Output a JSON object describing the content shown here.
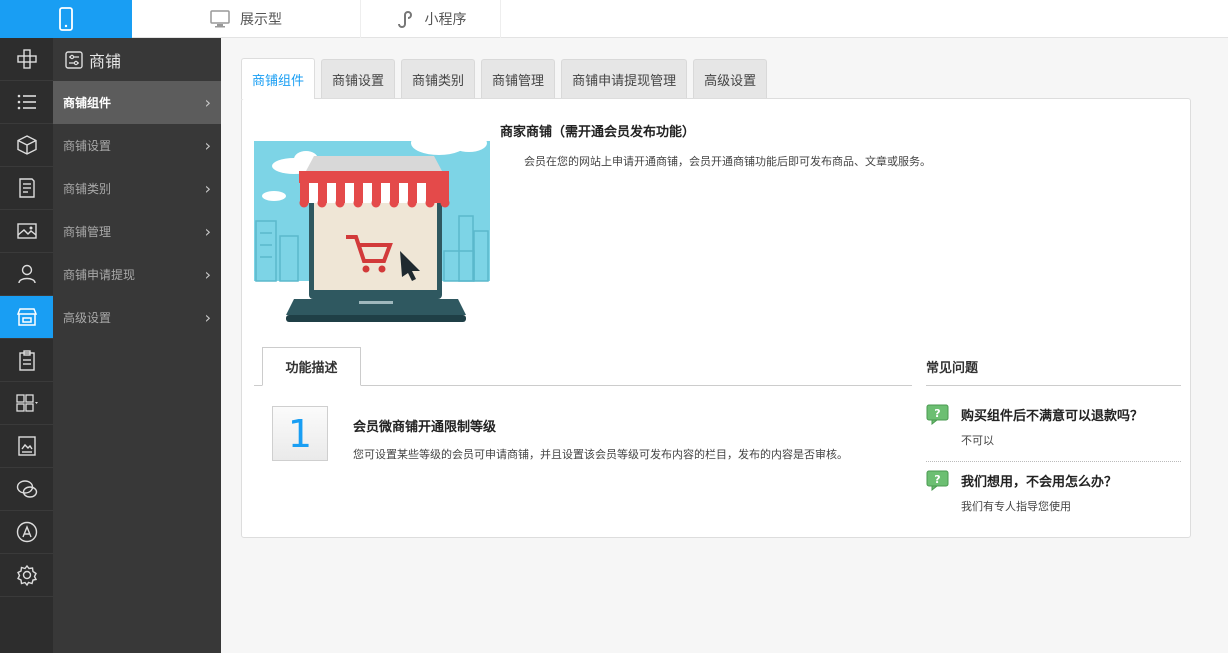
{
  "topbar": {
    "phone_icon": "phone-icon",
    "tabs": [
      {
        "label": "展示型",
        "icon": "monitor-icon"
      },
      {
        "label": "小程序",
        "icon": "miniprogram-icon"
      }
    ]
  },
  "rail": {
    "items": [
      "component-icon",
      "list-icon",
      "cube-icon",
      "document-icon",
      "image-icon",
      "user-icon",
      "store-icon",
      "clipboard-icon",
      "grid-icon",
      "gallery-icon",
      "wechat-icon",
      "appstore-icon",
      "settings-icon"
    ],
    "active": "store-icon",
    "accent": "#199ef3"
  },
  "submenu": {
    "title": "商铺",
    "items": [
      {
        "label": "商铺组件",
        "active": true
      },
      {
        "label": "商铺设置"
      },
      {
        "label": "商铺类别"
      },
      {
        "label": "商铺管理"
      },
      {
        "label": "商铺申请提现"
      },
      {
        "label": "高级设置"
      }
    ]
  },
  "tabs": [
    "商铺组件",
    "商铺设置",
    "商铺类别",
    "商铺管理",
    "商铺申请提现管理",
    "高级设置"
  ],
  "intro": {
    "title": "商家商铺（需开通会员发布功能）",
    "desc": "会员在您的网站上申请开通商铺，会员开通商铺功能后即可发布商品、文章或服务。"
  },
  "description": {
    "tab_label": "功能描述",
    "feature": {
      "number": "1",
      "title": "会员微商铺开通限制等级",
      "desc": "您可设置某些等级的会员可申请商铺，并且设置该会员等级可发布内容的栏目，发布的内容是否审核。"
    }
  },
  "faq": {
    "title": "常见问题",
    "items": [
      {
        "q": "购买组件后不满意可以退款吗？",
        "a": "不可以"
      },
      {
        "q": "我们想用，不会用怎么办？",
        "a": "我们有专人指导您使用"
      }
    ]
  }
}
